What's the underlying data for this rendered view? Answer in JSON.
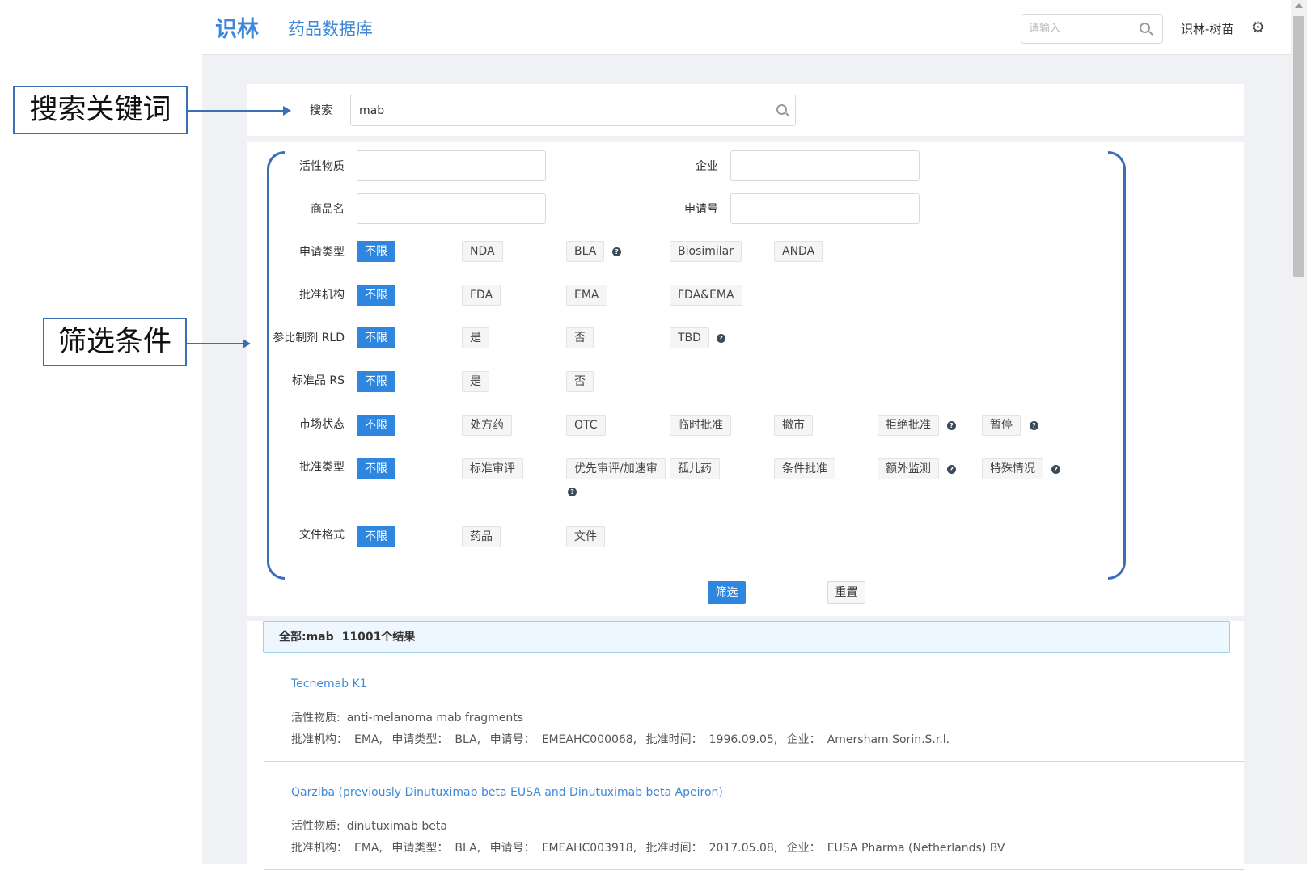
{
  "header": {
    "brand": "识林",
    "module": "药品数据库",
    "search_placeholder": "请输入",
    "user": "识林-树苗"
  },
  "search": {
    "label": "搜索",
    "value": "mab"
  },
  "filters": {
    "active_substance_label": "活性物质",
    "company_label": "企业",
    "trade_name_label": "商品名",
    "application_no_label": "申请号",
    "rows": [
      {
        "label": "申请类型",
        "options": [
          "不限",
          "NDA",
          "BLA",
          "Biosimilar",
          "ANDA"
        ]
      },
      {
        "label": "批准机构",
        "options": [
          "不限",
          "FDA",
          "EMA",
          "FDA&EMA"
        ]
      },
      {
        "label": "参比制剂 RLD",
        "options": [
          "不限",
          "是",
          "否",
          "TBD"
        ]
      },
      {
        "label": "标准品 RS",
        "options": [
          "不限",
          "是",
          "否"
        ]
      },
      {
        "label": "市场状态",
        "options": [
          "不限",
          "处方药",
          "OTC",
          "临时批准",
          "撤市",
          "拒绝批准",
          "暂停"
        ]
      },
      {
        "label": "批准类型",
        "options": [
          "不限",
          "标准审评",
          "优先审评/加速审",
          "孤儿药",
          "条件批准",
          "额外监测",
          "特殊情况"
        ]
      },
      {
        "label": "文件格式",
        "options": [
          "不限",
          "药品",
          "文件"
        ]
      }
    ],
    "help_mark": "?",
    "filter_button": "筛选",
    "reset_button": "重置"
  },
  "results": {
    "summary_prefix": "全部:mab",
    "summary_count": "11001个结果",
    "items": [
      {
        "title": "Tecnemab K1",
        "active_label": "活性物质:",
        "active": "anti-melanoma mab fragments",
        "agency_label": "批准机构：",
        "agency": "EMA,",
        "type_label": "申请类型：",
        "type": "BLA,",
        "app_label": "申请号：",
        "app_no": "EMEAHC000068,",
        "date_label": "批准时间：",
        "date": "1996.09.05,",
        "company_label": "企业：",
        "company": "Amersham Sorin.S.r.l."
      },
      {
        "title": "Qarziba (previously Dinutuximab beta EUSA and Dinutuximab beta Apeiron)",
        "active_label": "活性物质:",
        "active": "dinutuximab beta",
        "agency_label": "批准机构：",
        "agency": "EMA,",
        "type_label": "申请类型：",
        "type": "BLA,",
        "app_label": "申请号：",
        "app_no": "EMEAHC003918,",
        "date_label": "批准时间：",
        "date": "2017.05.08,",
        "company_label": "企业：",
        "company": "EUSA Pharma (Netherlands) BV"
      }
    ]
  },
  "annotations": {
    "keyword": "搜索关键词",
    "filter": "筛选条件"
  },
  "colors": {
    "accent": "#2e86de",
    "annotation": "#3a6fb6"
  }
}
